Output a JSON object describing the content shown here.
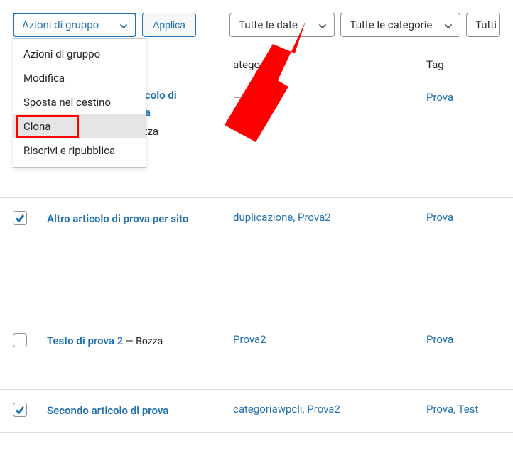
{
  "toolbar": {
    "bulk_select_label": "Azioni di gruppo",
    "apply_label": "Applica",
    "dates_label": "Tutte le date",
    "categories_label": "Tutte le categorie",
    "status_label": "Tutti"
  },
  "dropdown": {
    "items": [
      {
        "label": "Azioni di gruppo"
      },
      {
        "label": "Modifica"
      },
      {
        "label": "Sposta nel cestino"
      },
      {
        "label": "Clona",
        "hover": true,
        "highlighted": true
      },
      {
        "label": "Riscrivi e ripubblica"
      }
    ]
  },
  "columns": {
    "categories": "ategorie",
    "tag": "Tag"
  },
  "peek_row": {
    "title_line1": "icolo di",
    "title_line2": "la",
    "suffix": "zza",
    "categories": "—",
    "tags": "Prova"
  },
  "rows": [
    {
      "checked": true,
      "title": "Altro articolo di prova per sito",
      "categories": "duplicazione, Prova2",
      "tags": "Prova"
    },
    {
      "checked": false,
      "title": "Testo di prova 2",
      "title_suffix": " — Bozza",
      "categories": "Prova2",
      "tags": "Prova"
    },
    {
      "checked": true,
      "title": "Secondo articolo di prova",
      "categories": "categoriawpcli, Prova2",
      "tags": "Prova, Test"
    }
  ]
}
